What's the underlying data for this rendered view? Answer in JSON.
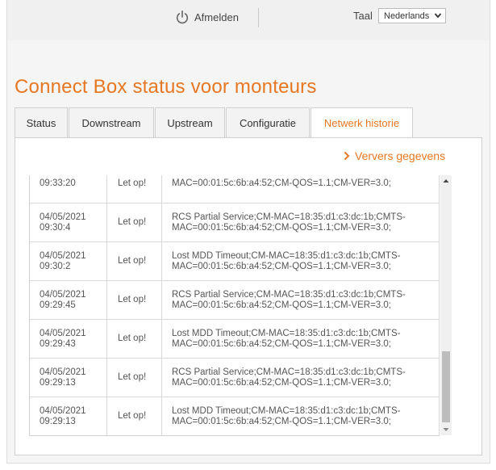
{
  "header": {
    "logout_label": "Afmelden",
    "language_label": "Taal",
    "language_selected": "Nederlands"
  },
  "page": {
    "title": "Connect Box status voor monteurs"
  },
  "tabs": [
    {
      "label": "Status",
      "active": false
    },
    {
      "label": "Downstream",
      "active": false
    },
    {
      "label": "Upstream",
      "active": false
    },
    {
      "label": "Configuratie",
      "active": false
    },
    {
      "label": "Netwerk historie",
      "active": true
    }
  ],
  "history": {
    "refresh_label": "Ververs gegevens",
    "rows": [
      {
        "date": "",
        "time": "09:33:20",
        "priority": "Let op!",
        "msg1": "",
        "msg2": "MAC=00:01:5c:6b:a4:52;CM-QOS=1.1;CM-VER=3.0;"
      },
      {
        "date": "04/05/2021",
        "time": "09:30:4",
        "priority": "Let op!",
        "msg1": "RCS Partial Service;CM-MAC=18:35:d1:c3:dc:1b;CMTS-",
        "msg2": "MAC=00:01:5c:6b:a4:52;CM-QOS=1.1;CM-VER=3.0;"
      },
      {
        "date": "04/05/2021",
        "time": "09:30:2",
        "priority": "Let op!",
        "msg1": "Lost MDD Timeout;CM-MAC=18:35:d1:c3:dc:1b;CMTS-",
        "msg2": "MAC=00:01:5c:6b:a4:52;CM-QOS=1.1;CM-VER=3.0;"
      },
      {
        "date": "04/05/2021",
        "time": "09:29:45",
        "priority": "Let op!",
        "msg1": "RCS Partial Service;CM-MAC=18:35:d1:c3:dc:1b;CMTS-",
        "msg2": "MAC=00:01:5c:6b:a4:52;CM-QOS=1.1;CM-VER=3.0;"
      },
      {
        "date": "04/05/2021",
        "time": "09:29:43",
        "priority": "Let op!",
        "msg1": "Lost MDD Timeout;CM-MAC=18:35:d1:c3:dc:1b;CMTS-",
        "msg2": "MAC=00:01:5c:6b:a4:52;CM-QOS=1.1;CM-VER=3.0;"
      },
      {
        "date": "04/05/2021",
        "time": "09:29:13",
        "priority": "Let op!",
        "msg1": "RCS Partial Service;CM-MAC=18:35:d1:c3:dc:1b;CMTS-",
        "msg2": "MAC=00:01:5c:6b:a4:52;CM-QOS=1.1;CM-VER=3.0;"
      },
      {
        "date": "04/05/2021",
        "time": "09:29:13",
        "priority": "Let op!",
        "msg1": "Lost MDD Timeout;CM-MAC=18:35:d1:c3:dc:1b;CMTS-",
        "msg2": "MAC=00:01:5c:6b:a4:52;CM-QOS=1.1;CM-VER=3.0;"
      }
    ]
  },
  "colors": {
    "accent": "#e87722"
  }
}
